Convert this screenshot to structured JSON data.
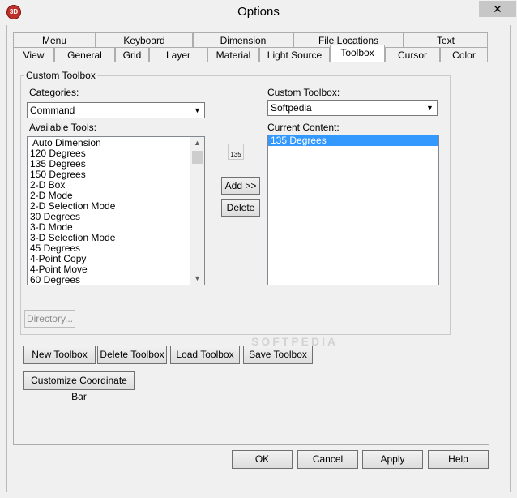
{
  "window": {
    "title": "Options",
    "close": "✕",
    "app_icon": "3D"
  },
  "tabs": {
    "row_back": [
      "Menu",
      "Keyboard",
      "Dimension",
      "File Locations",
      "Text"
    ],
    "row_front": [
      "View",
      "General",
      "Grid",
      "Layer",
      "Material",
      "Light Source",
      "Toolbox",
      "Cursor",
      "Color"
    ],
    "active": "Toolbox"
  },
  "group": {
    "title": "Custom Toolbox"
  },
  "categories": {
    "label": "Categories:",
    "value": "Command"
  },
  "available_tools": {
    "label": "Available Tools:",
    "items": [
      "Auto Dimension",
      "120 Degrees",
      "135 Degrees",
      "150 Degrees",
      "2-D Box",
      "2-D Mode",
      "2-D Selection Mode",
      "30 Degrees",
      "3-D Mode",
      "3-D Selection Mode",
      "45 Degrees",
      "4-Point Copy",
      "4-Point Move",
      "60 Degrees"
    ]
  },
  "preview_icon": {
    "text": "135",
    "icon": "angle-135-icon"
  },
  "middle_buttons": {
    "add": "Add >>",
    "delete": "Delete"
  },
  "custom_toolbox": {
    "label": "Custom Toolbox:",
    "value": "Softpedia"
  },
  "current_content": {
    "label": "Current Content:",
    "items": [
      "135 Degrees"
    ],
    "selected_index": 0
  },
  "directory_button": "Directory...",
  "toolbox_buttons": {
    "new": "New Toolbox",
    "delete": "Delete Toolbox",
    "load": "Load Toolbox",
    "save": "Save Toolbox"
  },
  "coordinate_button": "Customize Coordinate Bar",
  "watermark": "SOFTPEDIA",
  "dialog_buttons": {
    "ok": "OK",
    "cancel": "Cancel",
    "apply": "Apply",
    "help": "Help"
  }
}
